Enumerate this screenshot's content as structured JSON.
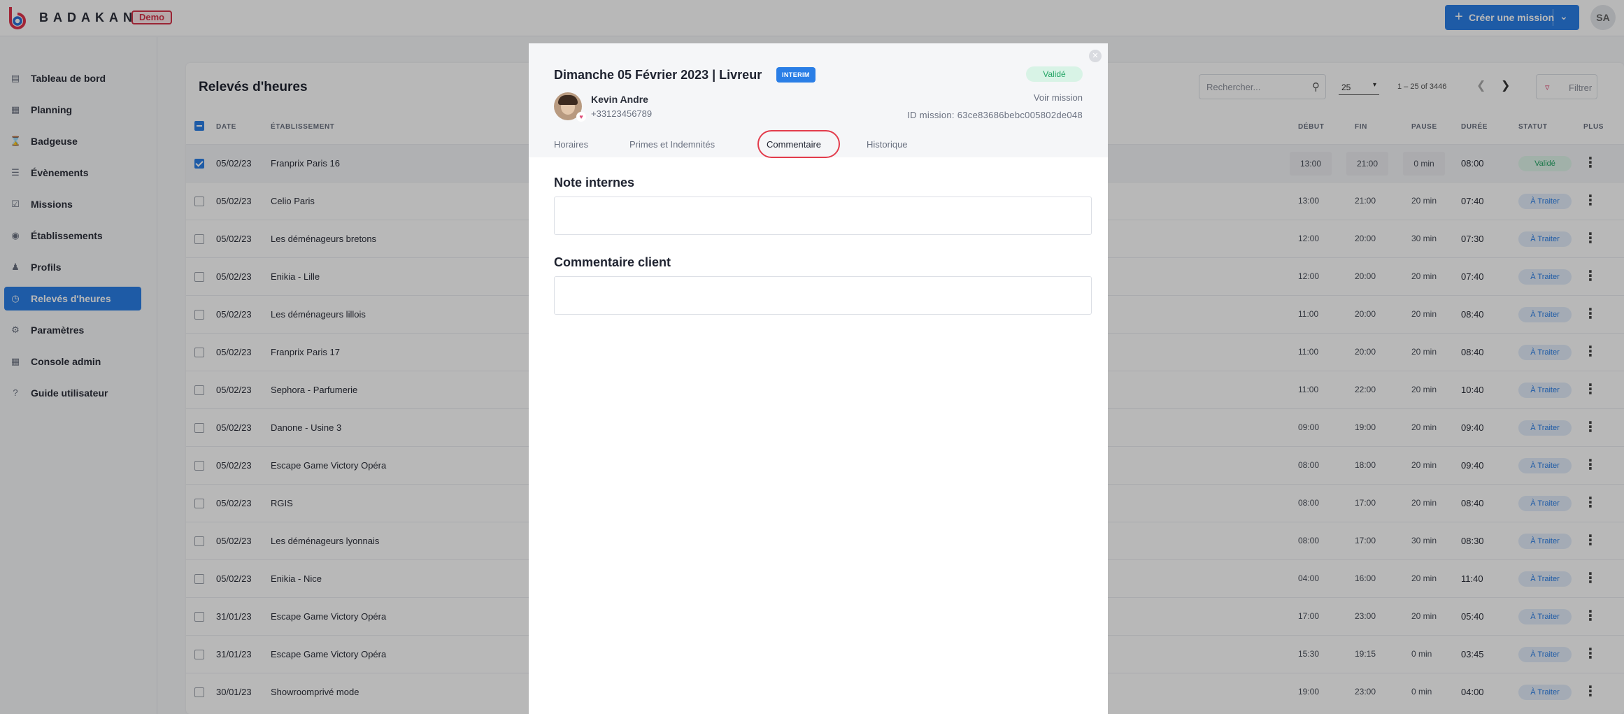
{
  "app": {
    "brand": "BADAKAN",
    "env_badge": "Demo",
    "create_button": "Créer une mission",
    "user_initials": "SA"
  },
  "sidebar": {
    "items": [
      {
        "label": "Tableau de bord",
        "icon": "chart-icon"
      },
      {
        "label": "Planning",
        "icon": "calendar-icon"
      },
      {
        "label": "Badgeuse",
        "icon": "hourglass-icon"
      },
      {
        "label": "Évènements",
        "icon": "list-icon"
      },
      {
        "label": "Missions",
        "icon": "checkbox-icon"
      },
      {
        "label": "Établissements",
        "icon": "location-icon"
      },
      {
        "label": "Profils",
        "icon": "users-icon"
      },
      {
        "label": "Relevés d'heures",
        "icon": "clock-icon",
        "active": true
      },
      {
        "label": "Paramètres",
        "icon": "gear-icon"
      },
      {
        "label": "Console admin",
        "icon": "grid-icon"
      },
      {
        "label": "Guide utilisateur",
        "icon": "help-icon"
      }
    ]
  },
  "table": {
    "title": "Relevés d'heures",
    "search_placeholder": "Rechercher...",
    "per_page": "25",
    "range": "1 – 25 of 3446",
    "filter_label": "Filtrer",
    "columns": {
      "date": "DATE",
      "etab": "ÉTABLISSEMENT",
      "debut": "DÉBUT",
      "fin": "FIN",
      "pause": "PAUSE",
      "duree": "DURÉE",
      "statut": "STATUT",
      "plus": "PLUS"
    },
    "rows": [
      {
        "date": "05/02/23",
        "etab": "Franprix Paris 16",
        "debut": "13:00",
        "fin": "21:00",
        "pause": "0 min",
        "duree": "08:00",
        "statut": "Validé",
        "selected": true
      },
      {
        "date": "05/02/23",
        "etab": "Celio Paris",
        "debut": "13:00",
        "fin": "21:00",
        "pause": "20 min",
        "duree": "07:40",
        "statut": "À Traiter"
      },
      {
        "date": "05/02/23",
        "etab": "Les déménageurs bretons",
        "debut": "12:00",
        "fin": "20:00",
        "pause": "30 min",
        "duree": "07:30",
        "statut": "À Traiter"
      },
      {
        "date": "05/02/23",
        "etab": "Enikia - Lille",
        "debut": "12:00",
        "fin": "20:00",
        "pause": "20 min",
        "duree": "07:40",
        "statut": "À Traiter"
      },
      {
        "date": "05/02/23",
        "etab": "Les déménageurs lillois",
        "debut": "11:00",
        "fin": "20:00",
        "pause": "20 min",
        "duree": "08:40",
        "statut": "À Traiter"
      },
      {
        "date": "05/02/23",
        "etab": "Franprix Paris 17",
        "debut": "11:00",
        "fin": "20:00",
        "pause": "20 min",
        "duree": "08:40",
        "statut": "À Traiter"
      },
      {
        "date": "05/02/23",
        "etab": "Sephora - Parfumerie",
        "debut": "11:00",
        "fin": "22:00",
        "pause": "20 min",
        "duree": "10:40",
        "statut": "À Traiter"
      },
      {
        "date": "05/02/23",
        "etab": "Danone - Usine 3",
        "debut": "09:00",
        "fin": "19:00",
        "pause": "20 min",
        "duree": "09:40",
        "statut": "À Traiter"
      },
      {
        "date": "05/02/23",
        "etab": "Escape Game Victory Opéra",
        "debut": "08:00",
        "fin": "18:00",
        "pause": "20 min",
        "duree": "09:40",
        "statut": "À Traiter"
      },
      {
        "date": "05/02/23",
        "etab": "RGIS",
        "debut": "08:00",
        "fin": "17:00",
        "pause": "20 min",
        "duree": "08:40",
        "statut": "À Traiter"
      },
      {
        "date": "05/02/23",
        "etab": "Les déménageurs lyonnais",
        "debut": "08:00",
        "fin": "17:00",
        "pause": "30 min",
        "duree": "08:30",
        "statut": "À Traiter"
      },
      {
        "date": "05/02/23",
        "etab": "Enikia - Nice",
        "debut": "04:00",
        "fin": "16:00",
        "pause": "20 min",
        "duree": "11:40",
        "statut": "À Traiter"
      },
      {
        "date": "31/01/23",
        "etab": "Escape Game Victory Opéra",
        "debut": "17:00",
        "fin": "23:00",
        "pause": "20 min",
        "duree": "05:40",
        "statut": "À Traiter"
      },
      {
        "date": "31/01/23",
        "etab": "Escape Game Victory Opéra",
        "debut": "15:30",
        "fin": "19:15",
        "pause": "0 min",
        "duree": "03:45",
        "statut": "À Traiter"
      },
      {
        "date": "30/01/23",
        "etab": "Showroomprivé mode",
        "debut": "19:00",
        "fin": "23:00",
        "pause": "0 min",
        "duree": "04:00",
        "statut": "À Traiter"
      }
    ]
  },
  "modal": {
    "title": "Dimanche 05 Février 2023 | Livreur",
    "contract_badge": "INTERIM",
    "status": "Validé",
    "person_name": "Kevin Andre",
    "person_phone": "+33123456789",
    "see_mission": "Voir mission",
    "mission_id": "ID mission: 63ce83686bebc005802de048",
    "tabs": [
      "Horaires",
      "Primes et Indemnités",
      "Commentaire",
      "Historique"
    ],
    "active_tab": "Commentaire",
    "section_internal": "Note internes",
    "section_client": "Commentaire client",
    "internal_note_value": "",
    "client_comment_value": ""
  }
}
